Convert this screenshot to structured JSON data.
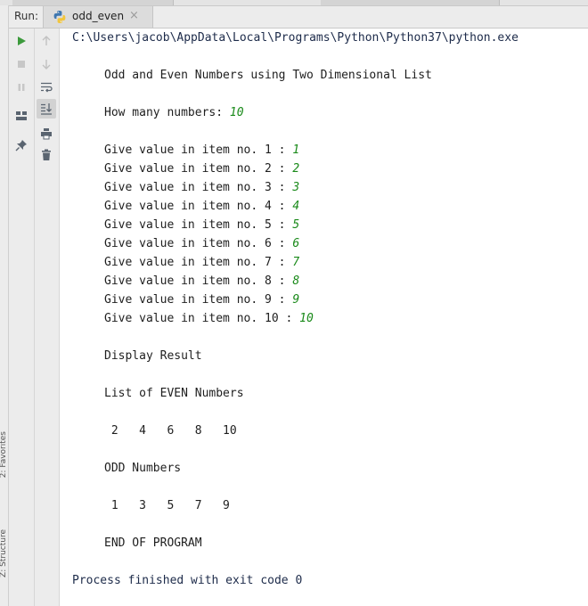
{
  "run_panel": {
    "run_label": "Run:",
    "tab_label": "odd_even",
    "close_glyph": "×",
    "python_icon": "python-icon"
  },
  "side_labels": {
    "favorites": "2: Favorites",
    "structure": "Z: Structure"
  },
  "toolbar": {
    "column1": [
      "run-icon",
      "stop-icon",
      "pause-icon",
      "layout-icon",
      "pin-icon"
    ],
    "column2": [
      "arrow-up-icon",
      "arrow-down-icon",
      "soft-wrap-icon",
      "scroll-to-end-icon",
      "print-icon",
      "trash-icon"
    ]
  },
  "console": {
    "command": "C:\\Users\\jacob\\AppData\\Local\\Programs\\Python\\Python37\\python.exe",
    "title": "Odd and Even Numbers using Two Dimensional List",
    "count_prompt": "How many numbers: ",
    "count_value": "10",
    "items": [
      {
        "prompt": "Give value in item no. 1 : ",
        "value": "1"
      },
      {
        "prompt": "Give value in item no. 2 : ",
        "value": "2"
      },
      {
        "prompt": "Give value in item no. 3 : ",
        "value": "3"
      },
      {
        "prompt": "Give value in item no. 4 : ",
        "value": "4"
      },
      {
        "prompt": "Give value in item no. 5 : ",
        "value": "5"
      },
      {
        "prompt": "Give value in item no. 6 : ",
        "value": "6"
      },
      {
        "prompt": "Give value in item no. 7 : ",
        "value": "7"
      },
      {
        "prompt": "Give value in item no. 8 : ",
        "value": "8"
      },
      {
        "prompt": "Give value in item no. 9 : ",
        "value": "9"
      },
      {
        "prompt": "Give value in item no. 10 : ",
        "value": "10"
      }
    ],
    "display_result": "Display Result",
    "even_header": "List of EVEN Numbers",
    "even_values": " 2   4   6   8   10",
    "odd_header": "ODD Numbers",
    "odd_values": " 1   3   5   7   9",
    "end": "END OF PROGRAM",
    "exit": "Process finished with exit code 0"
  },
  "colors": {
    "user_input": "#1a8a1a",
    "run_green": "#3c9a3c",
    "path_text": "#1d2b4a"
  }
}
